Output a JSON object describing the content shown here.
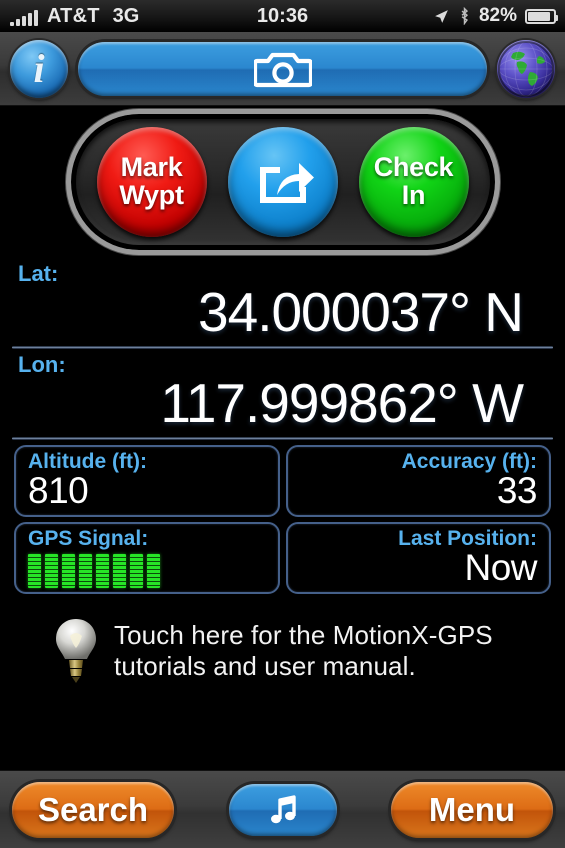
{
  "status_bar": {
    "signal_icon": "cellular-signal-icon",
    "carrier": "AT&T",
    "network_type": "3G",
    "time": "10:36",
    "location_icon": "location-arrow-icon",
    "bluetooth_icon": "bluetooth-icon",
    "battery_percent": "82%",
    "battery_icon": "battery-icon",
    "battery_level": 82
  },
  "top_toolbar": {
    "info_label": "i",
    "info_icon": "info-icon",
    "camera_icon": "camera-icon",
    "globe_icon": "globe-icon"
  },
  "action_pod": {
    "buttons": [
      {
        "name": "mark-waypoint",
        "line1": "Mark",
        "line2": "Wypt",
        "color": "#f01b14"
      },
      {
        "name": "share",
        "icon": "share-arrow-icon",
        "color": "#22a0ec"
      },
      {
        "name": "check-in",
        "line1": "Check",
        "line2": "In",
        "color": "#11d416"
      }
    ]
  },
  "readouts": {
    "lat": {
      "label": "Lat:",
      "value": "34.000037° N"
    },
    "lon": {
      "label": "Lon:",
      "value": "117.999862° W"
    },
    "altitude": {
      "label": "Altitude (ft):",
      "value": "810"
    },
    "accuracy": {
      "label": "Accuracy (ft):",
      "value": "33"
    },
    "gps_signal": {
      "label": "GPS Signal:",
      "bars_filled": 8,
      "bars_total": 8,
      "color": "#27e527"
    },
    "last_position": {
      "label": "Last Position:",
      "value": "Now"
    }
  },
  "hint": {
    "icon": "lightbulb-icon",
    "line1": "Touch here for the MotionX-GPS",
    "line2": "tutorials and user manual."
  },
  "bottom_toolbar": {
    "search_label": "Search",
    "music_icon": "music-note-icon",
    "menu_label": "Menu"
  },
  "colors": {
    "label_blue": "#57b2ee",
    "accent_orange": "#dd6c15",
    "accent_blue": "#2b87cf",
    "signal_green": "#27e527",
    "panel_border": "#45608a"
  }
}
